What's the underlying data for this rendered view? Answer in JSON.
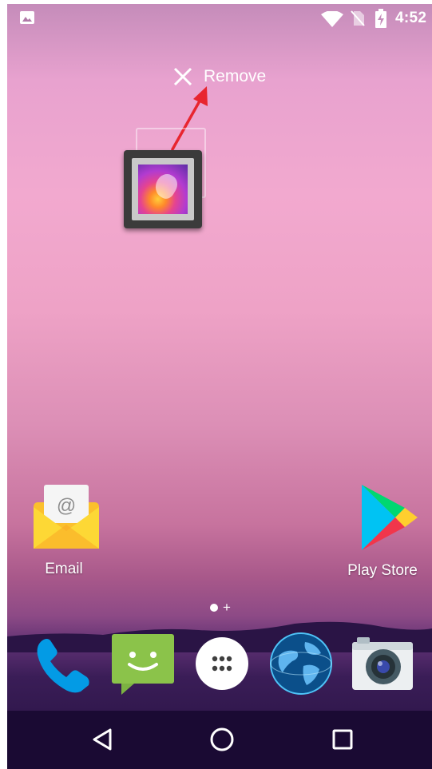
{
  "status_bar": {
    "time": "4:52",
    "icons": [
      "gallery-notification-icon",
      "wifi-icon",
      "no-sim-icon",
      "battery-charging-icon"
    ]
  },
  "drop_target": {
    "label": "Remove",
    "icon": "close-icon"
  },
  "drag": {
    "dragged_item_icon": "gallery-app-icon",
    "annotation": "red-arrow-pointing-to-remove"
  },
  "home_apps": [
    {
      "label": "Email",
      "icon": "email-envelope-icon"
    },
    {
      "label": "Play Store",
      "icon": "play-store-icon"
    }
  ],
  "page_indicator": {
    "add_symbol": "+"
  },
  "dock": [
    {
      "name": "phone",
      "icon": "phone-icon"
    },
    {
      "name": "messaging",
      "icon": "messaging-icon"
    },
    {
      "name": "app-drawer",
      "icon": "app-drawer-icon"
    },
    {
      "name": "browser",
      "icon": "globe-icon"
    },
    {
      "name": "camera",
      "icon": "camera-icon"
    }
  ],
  "nav_bar": [
    "back-icon",
    "home-icon",
    "recents-icon"
  ],
  "colors": {
    "wallpaper_top": "#c58cba",
    "wallpaper_mid": "#f2a9cf",
    "wallpaper_bottom": "#24103f",
    "annotation_red": "#e8252f",
    "email_yellow": "#fbc02d",
    "messaging_green": "#8bc34a",
    "phone_blue": "#039be5"
  }
}
